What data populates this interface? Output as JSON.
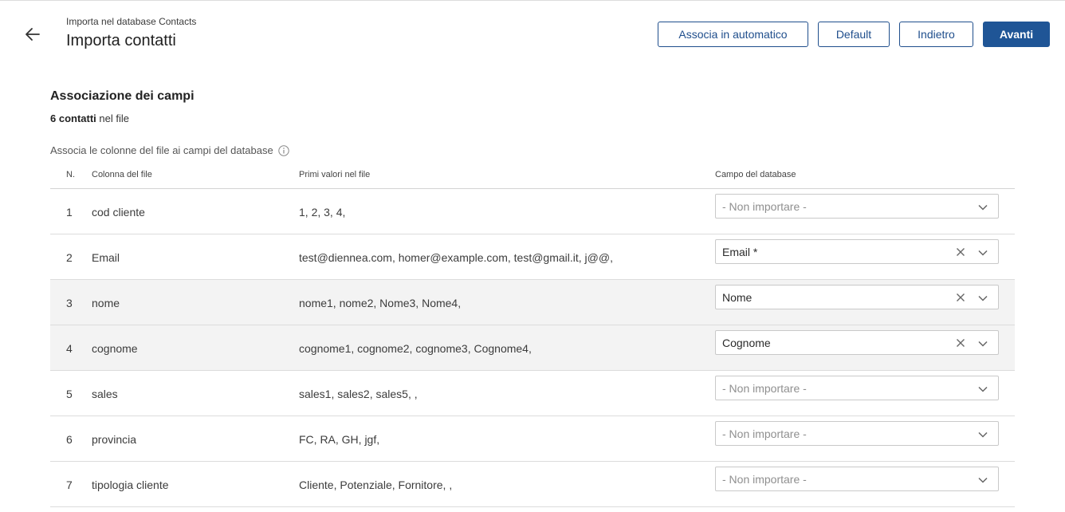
{
  "header": {
    "subtitle": "Importa nel database Contacts",
    "title": "Importa contatti",
    "buttons": {
      "auto": "Associa in automatico",
      "default": "Default",
      "back": "Indietro",
      "next": "Avanti"
    }
  },
  "section": {
    "title": "Associazione dei campi",
    "count_bold": "6 contatti",
    "count_rest": " nel file",
    "hint": "Associa le colonne del file ai campi del database"
  },
  "table": {
    "headers": {
      "n": "N.",
      "column": "Colonna del file",
      "values": "Primi valori nel file",
      "db": "Campo del database"
    },
    "rows": [
      {
        "n": "1",
        "column": "cod cliente",
        "values": "1, 2, 3, 4,",
        "db": "- Non importare -"
      },
      {
        "n": "2",
        "column": "Email",
        "values": "test@diennea.com, homer@example.com, test@gmail.it, j@@,",
        "db": "Email *"
      },
      {
        "n": "3",
        "column": "nome",
        "values": "nome1, nome2, Nome3, Nome4,",
        "db": "Nome"
      },
      {
        "n": "4",
        "column": "cognome",
        "values": "cognome1, cognome2, cognome3, Cognome4,",
        "db": "Cognome"
      },
      {
        "n": "5",
        "column": "sales",
        "values": "sales1, sales2, sales5, ,",
        "db": "- Non importare -"
      },
      {
        "n": "6",
        "column": "provincia",
        "values": "FC, RA, GH, jgf,",
        "db": "- Non importare -"
      },
      {
        "n": "7",
        "column": "tipologia cliente",
        "values": "Cliente, Potenziale, Fornitore, ,",
        "db": "- Non importare -"
      }
    ]
  },
  "colors": {
    "primary": "#1f5596",
    "border": "#1f4e8c",
    "row_shade": "#f3f3f3"
  }
}
